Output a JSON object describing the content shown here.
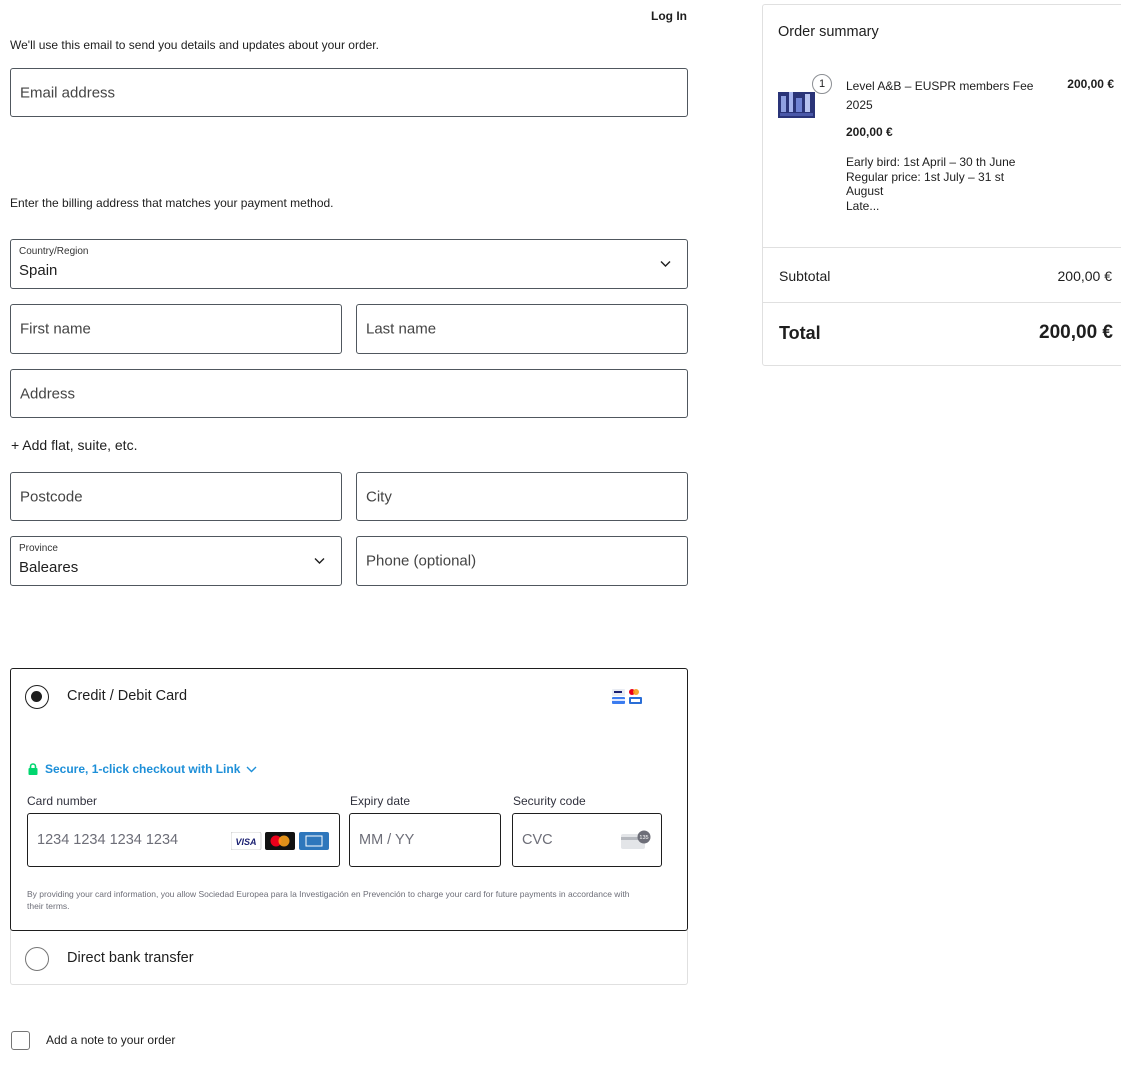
{
  "header": {
    "login_label": "Log In"
  },
  "contact": {
    "help_text": "We'll use this email to send you details and updates about your order.",
    "email_placeholder": "Email address"
  },
  "billing": {
    "help_text": "Enter the billing address that matches your payment method.",
    "country_label": "Country/Region",
    "country_value": "Spain",
    "first_name_placeholder": "First name",
    "last_name_placeholder": "Last name",
    "address_placeholder": "Address",
    "add_address_line": "+ Add flat, suite, etc.",
    "postcode_placeholder": "Postcode",
    "city_placeholder": "City",
    "province_label": "Province",
    "province_value": "Baleares",
    "phone_placeholder": "Phone (optional)"
  },
  "payment": {
    "methods": [
      {
        "label": "Credit / Debit Card",
        "selected": true
      },
      {
        "label": "Direct bank transfer",
        "selected": false
      }
    ],
    "link_text": "Secure, 1-click checkout with Link",
    "card_number_label": "Card number",
    "card_number_placeholder": "1234 1234 1234 1234",
    "expiry_label": "Expiry date",
    "expiry_placeholder": "MM / YY",
    "cvc_label": "Security code",
    "cvc_placeholder": "CVC",
    "card_brands": [
      "VISA",
      "mastercard",
      "amex"
    ],
    "cvc_badge": "135",
    "terms": "By providing your card information, you allow Sociedad Europea para la Investigación en Prevención to charge your card for future payments in accordance with their terms.",
    "link_color": "#1d8fd8",
    "lock_color": "#00d66f"
  },
  "note": {
    "label": "Add a note to your order"
  },
  "summary": {
    "title": "Order summary",
    "item": {
      "quantity": "1",
      "name": "Level A&B – EUSPR members Fee 2025",
      "price_right": "200,00 €",
      "price": "200,00 €",
      "description_lines": [
        "Early bird: 1st April – 30 th June",
        "Regular price: 1st July – 31 st",
        "August",
        "Late..."
      ]
    },
    "subtotal_label": "Subtotal",
    "subtotal_value": "200,00 €",
    "total_label": "Total",
    "total_value": "200,00 €"
  }
}
